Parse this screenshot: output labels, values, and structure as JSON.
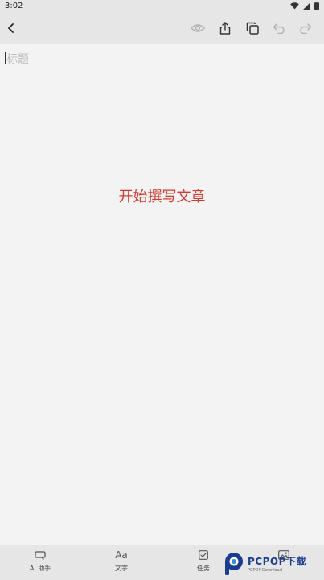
{
  "status_bar": {
    "time": "3:02",
    "icons": [
      "wifi-icon",
      "signal-icon",
      "battery-icon"
    ]
  },
  "toolbar": {
    "back": "back-icon",
    "actions": [
      "eye-icon",
      "share-icon",
      "copy-icon",
      "undo-icon",
      "redo-icon"
    ]
  },
  "editor": {
    "title_placeholder": "标题",
    "empty_prompt": "开始撰写文章"
  },
  "bottom_bar": {
    "items": [
      {
        "label": "AI 助手",
        "icon": "ai-assistant-icon"
      },
      {
        "label": "文字",
        "icon_text": "Aa"
      },
      {
        "label": "任务",
        "icon": "task-checkbox-icon"
      },
      {
        "label": "",
        "icon": "image-icon"
      }
    ]
  },
  "watermark": {
    "main": "PCPOP下载",
    "sub": "PCPOP Download"
  },
  "colors": {
    "accent_red": "#d23a2d",
    "bar_bg": "#e6e6e6",
    "page_bg": "#f3f3f3",
    "watermark_blue": "#1b3c8f"
  }
}
